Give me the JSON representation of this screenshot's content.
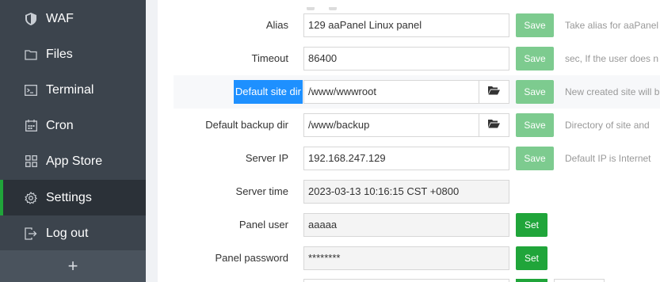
{
  "sidebar": {
    "items": [
      {
        "label": "WAF",
        "icon": "shield-icon"
      },
      {
        "label": "Files",
        "icon": "folder-icon"
      },
      {
        "label": "Terminal",
        "icon": "terminal-icon"
      },
      {
        "label": "Cron",
        "icon": "calendar-icon"
      },
      {
        "label": "App Store",
        "icon": "apps-grid-icon"
      },
      {
        "label": "Settings",
        "icon": "gear-icon",
        "active": true
      },
      {
        "label": "Log out",
        "icon": "logout-icon"
      }
    ],
    "add_label": "+"
  },
  "settings": {
    "alias": {
      "label": "Alias",
      "value": "129 aaPanel Linux panel",
      "button": "Save",
      "desc": "Take alias for aaPanel"
    },
    "timeout": {
      "label": "Timeout",
      "value": "86400",
      "button": "Save",
      "desc": "sec, If the user does n"
    },
    "site_dir": {
      "label": "Default site dir",
      "value": "/www/wwwroot",
      "button": "Save",
      "desc": "New created site will b"
    },
    "backup_dir": {
      "label": "Default backup dir",
      "value": "/www/backup",
      "button": "Save",
      "desc": "Directory of site and"
    },
    "server_ip": {
      "label": "Server IP",
      "value": "192.168.247.129",
      "button": "Save",
      "desc": "Default IP is Internet"
    },
    "server_time": {
      "label": "Server time",
      "value": "2023-03-13 10:16:15 CST +0800"
    },
    "panel_user": {
      "label": "Panel user",
      "value": "aaaaa",
      "button": "Set"
    },
    "panel_password": {
      "label": "Panel password",
      "value": "********",
      "button": "Set"
    }
  },
  "colors": {
    "accent": "#20a53a",
    "save_button": "#7dcb8f",
    "sidebar": "#3c444d",
    "selection": "#1e90ff"
  }
}
